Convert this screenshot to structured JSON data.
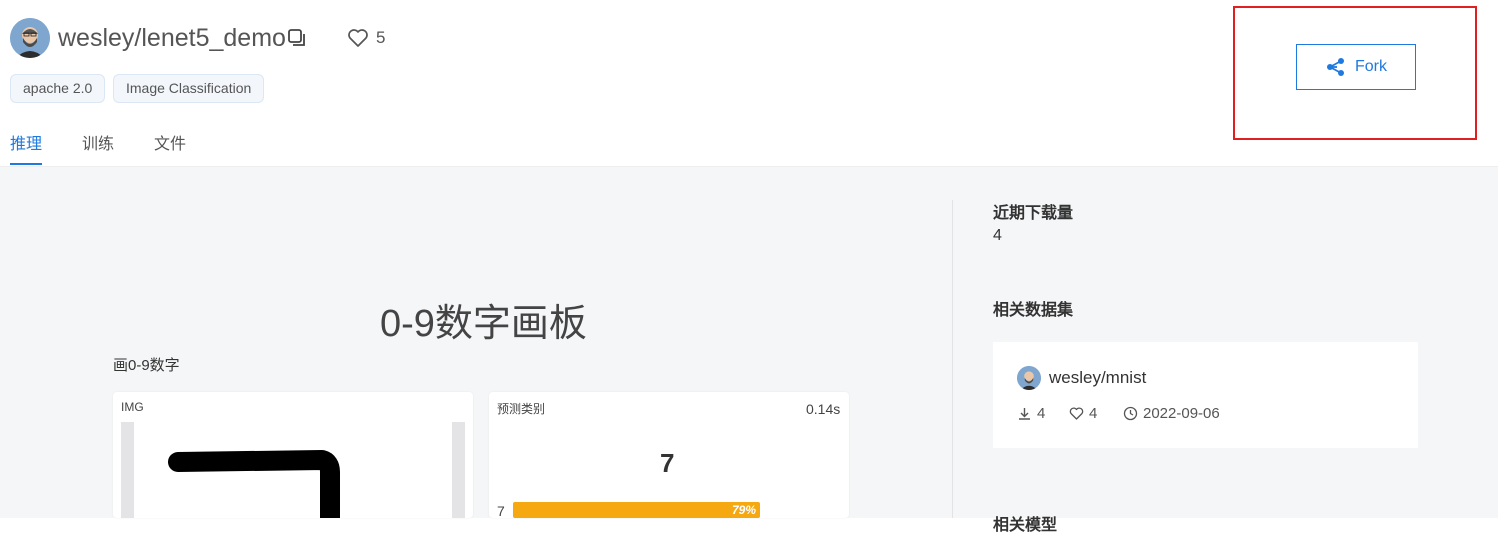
{
  "header": {
    "repo_title": "wesley/lenet5_demo",
    "like_count": "5",
    "tags": [
      "apache 2.0",
      "Image Classification"
    ],
    "tabs": [
      "推理",
      "训练",
      "文件"
    ],
    "fork_label": "Fork"
  },
  "board": {
    "title": "0-9数字画板",
    "subtitle": "画0-9数字",
    "input_label": "IMG",
    "output_label": "预测类别",
    "time": "0.14s",
    "predicted": "7",
    "bar_label": "7",
    "bar_percent": "79%"
  },
  "sidebar": {
    "downloads_heading": "近期下载量",
    "downloads_value": "4",
    "datasets_heading": "相关数据集",
    "dataset": {
      "name": "wesley/mnist",
      "downloads": "4",
      "likes": "4",
      "date": "2022-09-06"
    },
    "cut_heading": "相关模型"
  },
  "colors": {
    "accent": "#1f7ae0",
    "highlight_box": "#e02020",
    "bar": "#f5a80f"
  }
}
